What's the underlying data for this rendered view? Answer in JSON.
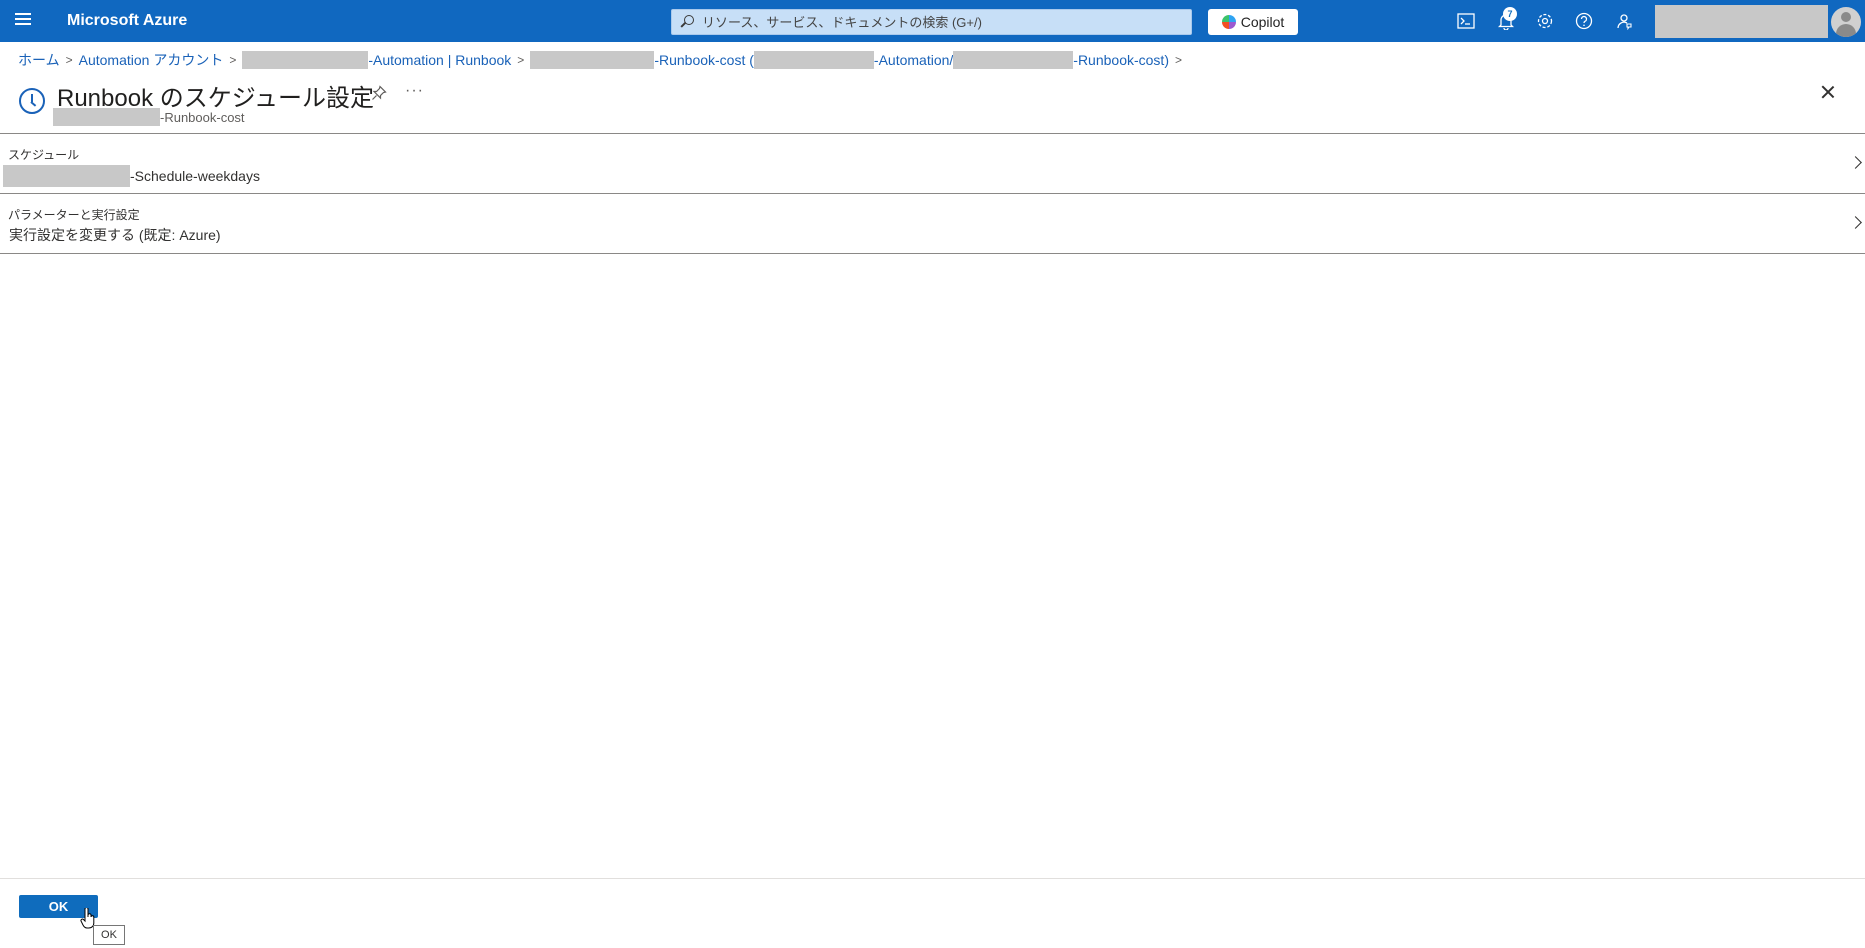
{
  "topbar": {
    "brand": "Microsoft Azure",
    "search_placeholder": "リソース、サービス、ドキュメントの検索 (G+/)",
    "copilot_label": "Copilot",
    "notification_count": "7",
    "colors": {
      "bar": "#1068c0",
      "accent": "#0f6cbd"
    }
  },
  "breadcrumb": {
    "home": "ホーム",
    "automation_accounts": "Automation アカウント",
    "account_suffix": "-Automation | Runbook",
    "runbook_suffix": "-Runbook-cost (",
    "path_mid": "-Automation/",
    "path_end": "-Runbook-cost)"
  },
  "header": {
    "title": "Runbook のスケジュール設定",
    "subtitle_suffix": "-Runbook-cost"
  },
  "rows": [
    {
      "label": "スケジュール",
      "value_suffix": "-Schedule-weekdays"
    },
    {
      "label": "パラメーターと実行設定",
      "value": "実行設定を変更する (既定: Azure)"
    }
  ],
  "footer": {
    "ok_label": "OK",
    "tooltip": "OK"
  }
}
